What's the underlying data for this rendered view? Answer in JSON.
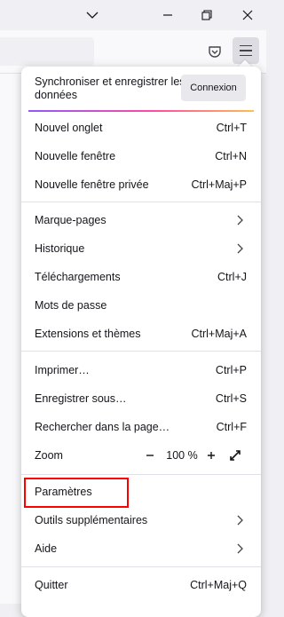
{
  "window": {
    "titlebar_icons": [
      "chevron-down-icon",
      "minimize-icon",
      "restore-icon",
      "close-icon"
    ]
  },
  "toolbar": {
    "icons": [
      "pocket-icon",
      "menu-icon"
    ]
  },
  "menu": {
    "sync": {
      "text": "Synchroniser et enregistrer les données",
      "button": "Connexion"
    },
    "items": {
      "new_tab": {
        "label": "Nouvel onglet",
        "shortcut": "Ctrl+T"
      },
      "new_window": {
        "label": "Nouvelle fenêtre",
        "shortcut": "Ctrl+N"
      },
      "private_window": {
        "label": "Nouvelle fenêtre privée",
        "shortcut": "Ctrl+Maj+P"
      },
      "bookmarks": {
        "label": "Marque-pages"
      },
      "history": {
        "label": "Historique"
      },
      "downloads": {
        "label": "Téléchargements",
        "shortcut": "Ctrl+J"
      },
      "passwords": {
        "label": "Mots de passe"
      },
      "addons": {
        "label": "Extensions et thèmes",
        "shortcut": "Ctrl+Maj+A"
      },
      "print": {
        "label": "Imprimer…",
        "shortcut": "Ctrl+P"
      },
      "save_as": {
        "label": "Enregistrer sous…",
        "shortcut": "Ctrl+S"
      },
      "find": {
        "label": "Rechercher dans la page…",
        "shortcut": "Ctrl+F"
      },
      "settings": {
        "label": "Paramètres"
      },
      "more_tools": {
        "label": "Outils supplémentaires"
      },
      "help": {
        "label": "Aide"
      },
      "quit": {
        "label": "Quitter",
        "shortcut": "Ctrl+Maj+Q"
      }
    },
    "zoom": {
      "label": "Zoom",
      "value": "100 %",
      "minus": "−",
      "plus": "+"
    }
  },
  "colors": {
    "highlight": "#ff0000",
    "accent_gradient": [
      "#9059ff",
      "#ff4aa2",
      "#ffbd4f"
    ]
  }
}
